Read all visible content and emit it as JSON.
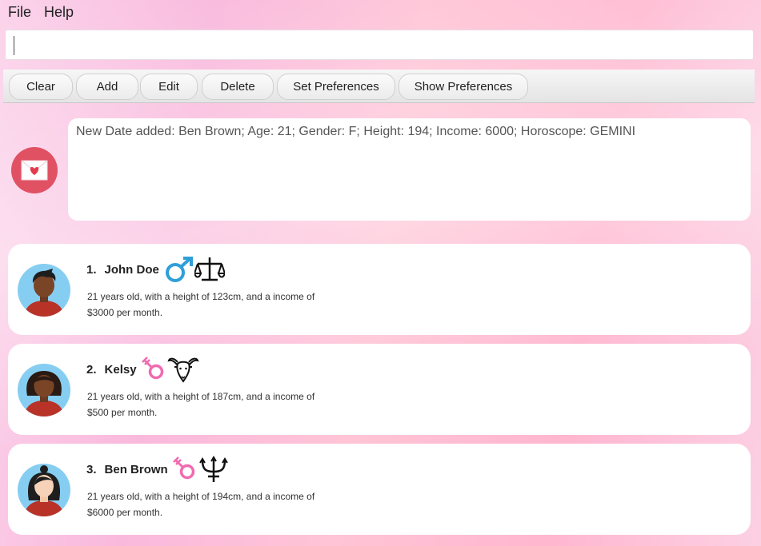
{
  "menu": {
    "file": "File",
    "help": "Help"
  },
  "command": {
    "value": ""
  },
  "toolbar": {
    "clear": "Clear",
    "add": "Add",
    "edit": "Edit",
    "delete": "Delete",
    "set_preferences": "Set Preferences",
    "show_preferences": "Show Preferences"
  },
  "result": {
    "icon": "love-letter-icon",
    "message": "New Date added: Ben Brown; Age: 21; Gender: F; Height: 194; Income: 6000; Horoscope: GEMINI"
  },
  "people": [
    {
      "index": "1.",
      "name": "John Doe",
      "gender_icon": "male-icon",
      "horoscope_icon": "libra-icon",
      "line1": "21 years old, with a height of 123cm, and a income of",
      "line2": "$3000 per month."
    },
    {
      "index": "2.",
      "name": "Kelsy",
      "gender_icon": "female-icon",
      "horoscope_icon": "capricorn-goat-icon",
      "line1": "21 years old, with a height of 187cm, and a income of",
      "line2": "$500 per month."
    },
    {
      "index": "3.",
      "name": "Ben Brown",
      "gender_icon": "female-icon",
      "horoscope_icon": "trident-icon",
      "line1": "21 years old, with a height of 194cm, and a income of",
      "line2": "$6000 per month."
    }
  ],
  "colors": {
    "accent_red": "#e05263",
    "male_blue": "#2f9fd8",
    "female_pink": "#f06bb0",
    "avatar_bg": "#86cdf2"
  }
}
